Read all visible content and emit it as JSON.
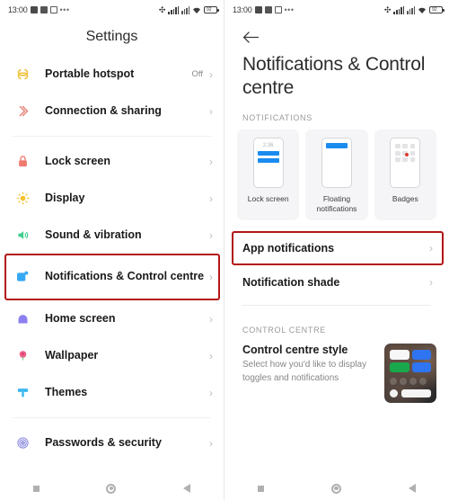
{
  "status_bar": {
    "time": "13:00",
    "left_icons": [
      "app-icon-1",
      "app-icon-2",
      "app-icon-3",
      "overflow-dots"
    ],
    "right_icons": [
      "bluetooth-icon",
      "signal-bars-icon",
      "signal-bars-2-icon",
      "wifi-icon",
      "battery-icon"
    ],
    "battery_level": "92"
  },
  "left_panel": {
    "title": "Settings",
    "groups": [
      {
        "items": [
          {
            "label": "Portable hotspot",
            "value": "Off",
            "icon": "hotspot-icon",
            "color": "#efc13e"
          },
          {
            "label": "Connection & sharing",
            "value": "",
            "icon": "connection-sharing-icon",
            "color": "#e8857b"
          }
        ]
      },
      {
        "items": [
          {
            "label": "Lock screen",
            "value": "",
            "icon": "lock-icon",
            "color": "#f07a6e"
          },
          {
            "label": "Display",
            "value": "",
            "icon": "sun-icon",
            "color": "#f5c32c"
          },
          {
            "label": "Sound & vibration",
            "value": "",
            "icon": "speaker-icon",
            "color": "#3ecf8e"
          },
          {
            "label": "Notifications & Control centre",
            "value": "",
            "icon": "notification-square-icon",
            "color": "#36a9f5",
            "highlighted": true
          },
          {
            "label": "Home screen",
            "value": "",
            "icon": "home-icon",
            "color": "#8b7ff0"
          },
          {
            "label": "Wallpaper",
            "value": "",
            "icon": "tulip-icon",
            "color": "#f2608a"
          },
          {
            "label": "Themes",
            "value": "",
            "icon": "brush-icon",
            "color": "#3bb8ef"
          }
        ]
      },
      {
        "items": [
          {
            "label": "Passwords & security",
            "value": "",
            "icon": "fingerprint-icon",
            "color": "#8d8de0"
          }
        ]
      }
    ]
  },
  "right_panel": {
    "back_icon": "back-arrow-icon",
    "title": "Notifications & Control centre",
    "sections": [
      {
        "label": "NOTIFICATIONS"
      },
      {
        "label": "CONTROL CENTRE"
      }
    ],
    "cards": [
      {
        "label": "Lock screen",
        "icon": "lock-screen-preview",
        "preview_time": "2:36"
      },
      {
        "label": "Floating notifications",
        "icon": "floating-notifications-preview"
      },
      {
        "label": "Badges",
        "icon": "badges-preview"
      }
    ],
    "rows": [
      {
        "label": "App notifications",
        "highlighted": true
      },
      {
        "label": "Notification shade",
        "highlighted": false
      }
    ],
    "control_centre": {
      "title": "Control centre style",
      "subtitle": "Select how you'd like to display toggles and notifications",
      "thumbnail": "control-centre-style-thumbnail"
    }
  },
  "nav_bar": {
    "buttons": [
      "recents-button",
      "home-button",
      "back-button"
    ]
  },
  "colors": {
    "highlight_border": "#b31515",
    "accent_blue": "#1a8cf0",
    "badge_red": "#e03b2f"
  }
}
